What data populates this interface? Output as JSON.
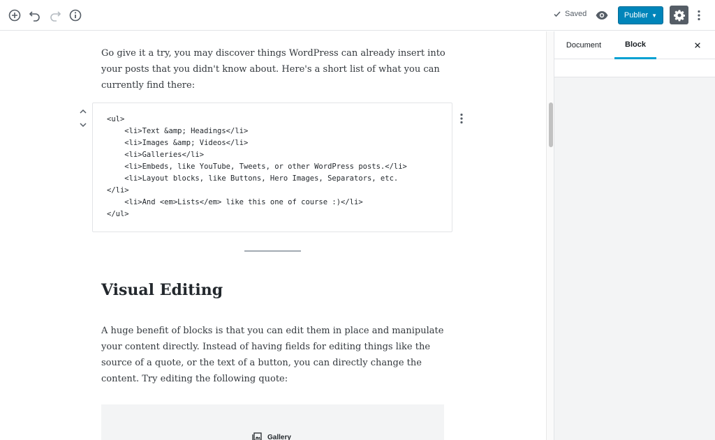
{
  "toolbar": {
    "saved_label": "Saved",
    "publish_label": "Publier",
    "icons": [
      "add-block-icon",
      "undo-icon",
      "redo-icon",
      "info-icon",
      "preview-eye-icon",
      "gear-icon",
      "more-vertical-icon"
    ]
  },
  "content": {
    "intro_paragraph": "Go give it a try, you may discover things WordPress can already insert into your posts that you didn't know about. Here's a short list of what you can currently find there:",
    "code": "<ul>\n    <li>Text &amp; Headings</li>\n    <li>Images &amp; Videos</li>\n    <li>Galleries</li>\n    <li>Embeds, like YouTube, Tweets, or other WordPress posts.</li>\n    <li>Layout blocks, like Buttons, Hero Images, Separators, etc.\n</li>\n    <li>And <em>Lists</em> like this one of course :)</li>\n</ul>",
    "heading": "Visual Editing",
    "body_paragraph": "A huge benefit of blocks is that you can edit them in place and manipulate your content directly. Instead of having fields for editing things like the source of a quote, or the text of a button, you can directly change the content. Try editing the following quote:",
    "gallery_label": "Gallery"
  },
  "sidebar": {
    "tabs": [
      {
        "label": "Document",
        "active": false
      },
      {
        "label": "Block",
        "active": true
      }
    ]
  },
  "colors": {
    "publish": "#0085ba",
    "active_tab": "#00a0d2",
    "settings_active": "#555d66"
  }
}
